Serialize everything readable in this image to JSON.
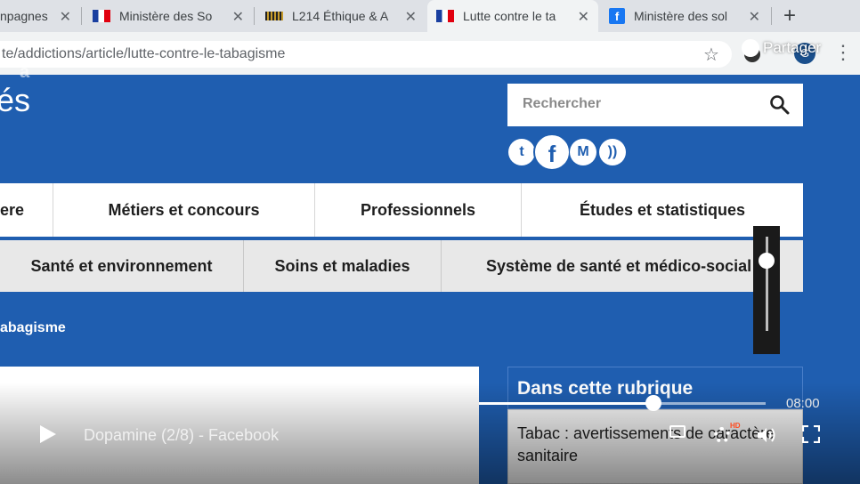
{
  "browser": {
    "tabs": [
      {
        "title": "npagnes",
        "favicon": "generic-icon"
      },
      {
        "title": "Ministère des So",
        "favicon": "french-flag-icon"
      },
      {
        "title": "L214 Éthique & A",
        "favicon": "l214-icon"
      },
      {
        "title": "Lutte contre le ta",
        "favicon": "french-flag-icon",
        "active": true
      },
      {
        "title": "Ministère des sol",
        "favicon": "facebook-icon"
      }
    ],
    "close_glyph": "✕",
    "new_tab_glyph": "+",
    "url": "te/addictions/article/lutte-contre-le-tabagisme",
    "share_label": "Partager",
    "avatar_letter": "G",
    "star_glyph": "☆",
    "menu_glyph": "⋮"
  },
  "site": {
    "logo_text": "és",
    "logo_watermark": "a",
    "search_placeholder": "Rechercher",
    "social": [
      {
        "icon": "twitter-icon",
        "glyph": "t"
      },
      {
        "icon": "facebook-icon",
        "glyph": "f"
      },
      {
        "icon": "marianne-icon",
        "glyph": "M"
      },
      {
        "icon": "rss-icon",
        "glyph": "))"
      }
    ],
    "nav_primary": [
      "ere",
      "Métiers et concours",
      "Professionnels",
      "Études et statistiques"
    ],
    "nav_secondary": [
      "Santé et environnement",
      "Soins et maladies",
      "Système de santé et médico-social"
    ],
    "breadcrumb": "abagisme",
    "sidebar": {
      "heading": "Dans cette rubrique",
      "item": "Tabac : avertissements de caractère sanitaire"
    }
  },
  "player": {
    "title": "Dopamine (2/8) - Facebook",
    "duration": "08:00",
    "progress": 0.61,
    "volume": 0.75,
    "hd_badge": "HD",
    "colors": {
      "accent": "#1f5eb0",
      "hd": "#ff4b1f"
    }
  }
}
